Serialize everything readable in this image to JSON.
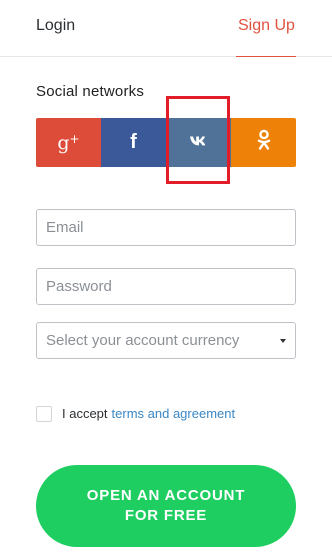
{
  "tabs": {
    "login_label": "Login",
    "signup_label": "Sign Up",
    "active": "Sign Up"
  },
  "social": {
    "title": "Social networks",
    "buttons": [
      {
        "name": "google-plus",
        "label": "g+",
        "color": "#dd4b39",
        "icon": "google-plus-icon"
      },
      {
        "name": "facebook",
        "label": "f",
        "color": "#3b5998",
        "icon": "facebook-icon"
      },
      {
        "name": "vk",
        "label": "vk",
        "color": "#507299",
        "icon": "vk-icon"
      },
      {
        "name": "odnoklassniki",
        "label": "ok",
        "color": "#ee8208",
        "icon": "odnoklassniki-icon"
      }
    ],
    "highlighted": "vk"
  },
  "form": {
    "email_placeholder": "Email",
    "email_value": "",
    "password_placeholder": "Password",
    "password_value": "",
    "currency_placeholder": "Select your account currency",
    "currency_selected": ""
  },
  "agreement": {
    "prefix": "I accept",
    "link_text": "terms and agreement",
    "checked": false
  },
  "cta": {
    "label": "OPEN AN ACCOUNT FOR FREE",
    "color": "#1ece61"
  },
  "colors": {
    "accent": "#e0533f",
    "link": "#3a87c6",
    "highlight": "#e21c28"
  }
}
